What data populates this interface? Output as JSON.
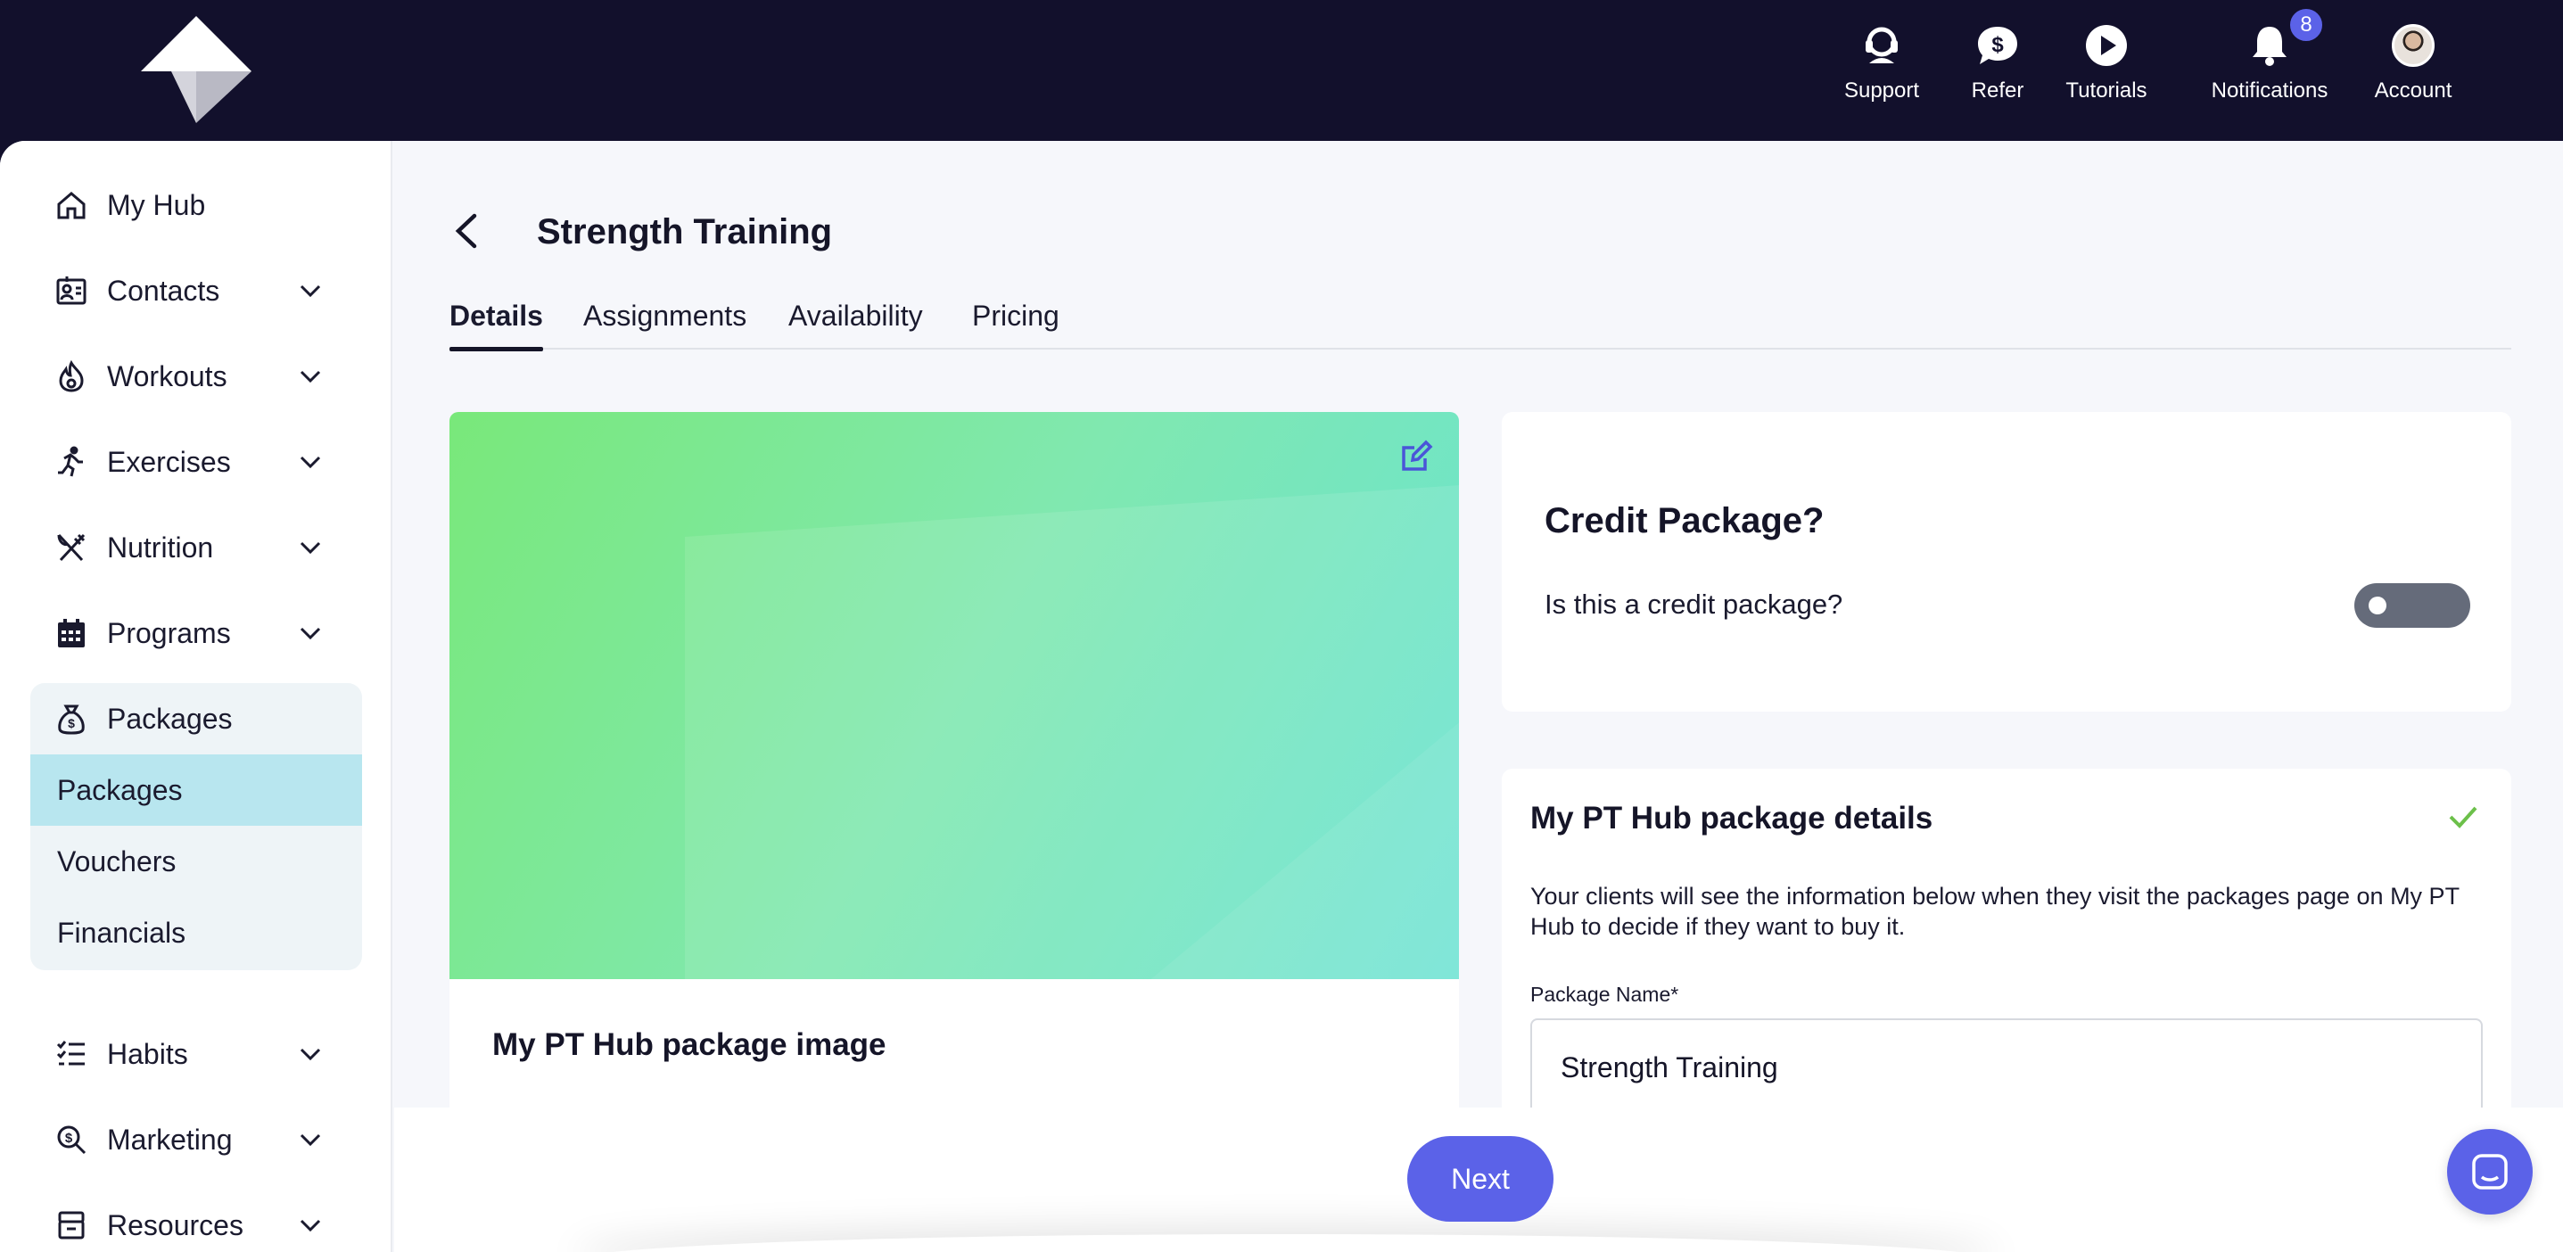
{
  "topnav": {
    "support_label": "Support",
    "refer_label": "Refer",
    "tutorials_label": "Tutorials",
    "notifications_label": "Notifications",
    "notifications_count": "8",
    "account_label": "Account"
  },
  "sidebar": {
    "items": [
      {
        "label": "My Hub",
        "icon": "home-icon"
      },
      {
        "label": "Contacts",
        "icon": "contacts-icon"
      },
      {
        "label": "Workouts",
        "icon": "flame-icon"
      },
      {
        "label": "Exercises",
        "icon": "running-icon"
      },
      {
        "label": "Nutrition",
        "icon": "utensils-icon"
      },
      {
        "label": "Programs",
        "icon": "calendar-icon"
      },
      {
        "label": "Packages",
        "icon": "money-bag-icon"
      },
      {
        "label": "Habits",
        "icon": "checklist-icon"
      },
      {
        "label": "Marketing",
        "icon": "search-dollar-icon"
      },
      {
        "label": "Resources",
        "icon": "archive-icon"
      }
    ],
    "packages_sub": [
      "Packages",
      "Vouchers",
      "Financials"
    ],
    "active_sub": "Packages"
  },
  "page": {
    "title": "Strength Training",
    "tabs": [
      "Details",
      "Assignments",
      "Availability",
      "Pricing"
    ],
    "active_tab": "Details"
  },
  "image_card": {
    "title": "My PT Hub package image"
  },
  "credit": {
    "title": "Credit Package?",
    "question": "Is this a credit package?",
    "toggle_on": false
  },
  "details": {
    "title": "My PT Hub package details",
    "description": "Your clients will see the information below when they visit the packages page on My PT Hub to decide if they want to buy it.",
    "package_name_label": "Package Name*",
    "package_name_value": "Strength Training"
  },
  "footer": {
    "next_label": "Next"
  },
  "colors": {
    "topbar_bg": "#12102c",
    "accent": "#5b62e8",
    "active_sub_bg": "#b8e6ef",
    "check_green": "#6cc04a"
  }
}
